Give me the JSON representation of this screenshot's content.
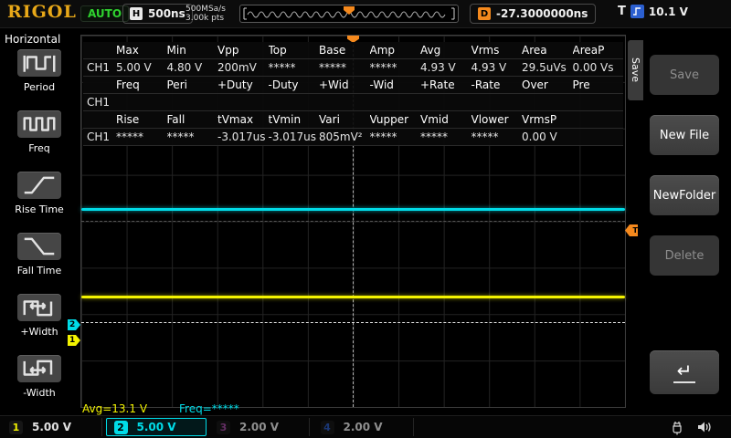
{
  "colors": {
    "ch1": "#f2f200",
    "ch2": "#00dce8",
    "ch3": "#b050b0",
    "ch4": "#2b5fd0",
    "trigger": "#f5891d",
    "logo": "#e8a818",
    "auto": "#2fd32f"
  },
  "top_bar": {
    "logo": "RIGOL",
    "mode": "AUTO",
    "h_label": "H",
    "timebase": "500ns",
    "sample_rate": "500MSa/s",
    "memory_depth": "3.00k pts",
    "delay_label": "D",
    "delay_value": "-27.3000000ns",
    "trigger_label": "T",
    "trigger_level": "10.1 V"
  },
  "left_menu": {
    "title": "Horizontal",
    "items": [
      {
        "label": "Period",
        "icon": "period-icon"
      },
      {
        "label": "Freq",
        "icon": "freq-icon"
      },
      {
        "label": "Rise Time",
        "icon": "rise-time-icon"
      },
      {
        "label": "Fall Time",
        "icon": "fall-time-icon"
      },
      {
        "label": "+Width",
        "icon": "plus-width-icon"
      },
      {
        "label": "-Width",
        "icon": "minus-width-icon"
      }
    ]
  },
  "measurements": {
    "rows": [
      {
        "ch": "",
        "type": "header",
        "cells": [
          "Max",
          "Min",
          "Vpp",
          "Top",
          "Base",
          "Amp",
          "Avg",
          "Vrms",
          "Area",
          "AreaP"
        ]
      },
      {
        "ch": "CH1",
        "type": "value",
        "cells": [
          "5.00 V",
          "4.80 V",
          "200mV",
          "*****",
          "*****",
          "*****",
          "4.93 V",
          "4.93 V",
          "29.5uVs",
          "0.00 Vs"
        ]
      },
      {
        "ch": "",
        "type": "header",
        "cells": [
          "Freq",
          "Peri",
          "+Duty",
          "-Duty",
          "+Wid",
          "-Wid",
          "+Rate",
          "-Rate",
          "Over",
          "Pre"
        ]
      },
      {
        "ch": "CH1",
        "type": "value",
        "cells": [
          "",
          "",
          "",
          "",
          "",
          "",
          "",
          "",
          "",
          ""
        ]
      },
      {
        "ch": "",
        "type": "header",
        "cells": [
          "Rise",
          "Fall",
          "tVmax",
          "tVmin",
          "Vari",
          "Vupper",
          "Vmid",
          "Vlower",
          "VrmsP",
          ""
        ]
      },
      {
        "ch": "CH1",
        "type": "value",
        "cells": [
          "*****",
          "*****",
          "-3.017us",
          "-3.017us",
          "805mV²",
          "*****",
          "*****",
          "*****",
          "0.00 V",
          ""
        ]
      }
    ]
  },
  "display": {
    "avg_readout": "Avg=13.1 V",
    "freq_readout": "Freq=*****",
    "ch1_marker": "1",
    "ch2_marker": "2",
    "trigger_marker": "T"
  },
  "right_menu": {
    "tab_label": "Save",
    "buttons": [
      {
        "label": "Save",
        "enabled": false
      },
      {
        "label": "New File",
        "enabled": true
      },
      {
        "label": "NewFolder",
        "enabled": true
      },
      {
        "label": "Delete",
        "enabled": false
      }
    ],
    "enter_icon": "↵"
  },
  "channel_bar": {
    "channels": [
      {
        "num": "1",
        "scale": "5.00 V",
        "color": "#f2f200",
        "scale_color": "#e0e0e0",
        "selected": false,
        "active": true
      },
      {
        "num": "2",
        "scale": "5.00 V",
        "color": "#00dce8",
        "scale_color": "#00dce8",
        "selected": true,
        "active": true
      },
      {
        "num": "3",
        "scale": "2.00 V",
        "color": "#b050b0",
        "scale_color": "#8f8f8f",
        "selected": false,
        "active": false
      },
      {
        "num": "4",
        "scale": "2.00 V",
        "color": "#2b5fd0",
        "scale_color": "#8f8f8f",
        "selected": false,
        "active": false
      }
    ]
  }
}
